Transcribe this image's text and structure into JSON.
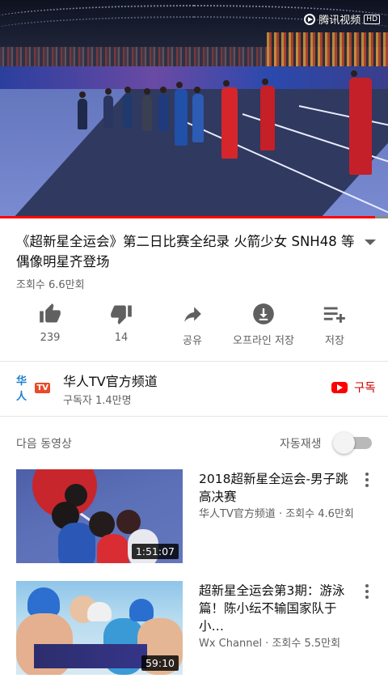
{
  "player": {
    "watermark": "腾讯视频",
    "watermark_badge": "HD",
    "progress_fraction": 0.967
  },
  "video": {
    "title": "《超新星全运会》第二日比赛全纪录 火箭少女 SNH48 等偶像明星齐登场",
    "views": "조회수 6.6만회"
  },
  "actions": [
    {
      "icon": "thumbs-up-icon",
      "label": "239"
    },
    {
      "icon": "thumbs-down-icon",
      "label": "14"
    },
    {
      "icon": "share-icon",
      "label": "공유"
    },
    {
      "icon": "download-icon",
      "label": "오프라인 저장"
    },
    {
      "icon": "add-to-playlist-icon",
      "label": "저장"
    }
  ],
  "channel": {
    "logo_text": "华人",
    "logo_badge": "TV",
    "name": "华人TV官方频道",
    "subscribers": "구독자 1.4만명",
    "subscribe_label": "구독"
  },
  "up_next": {
    "label": "다음 동영상",
    "autoplay_label": "자동재생",
    "autoplay_on": false
  },
  "videos": [
    {
      "title": "2018超新星全运会-男子跳高决赛",
      "channel": "华人TV官方频道",
      "views": "조회수 4.6만회",
      "meta": "华人TV官方频道 · 조회수 4.6만회",
      "duration": "1:51:07"
    },
    {
      "title": "超新星全运会第3期：游泳篇！陈小纭不输国家队于小…",
      "channel": "Wx Channel",
      "views": "조회수 5.5만회",
      "meta": "Wx Channel · 조회수 5.5만회",
      "duration": "59:10"
    }
  ],
  "colors": {
    "accent_red": "#ff0000",
    "subscribe_red": "#cc0000",
    "secondary_text": "#606060"
  }
}
